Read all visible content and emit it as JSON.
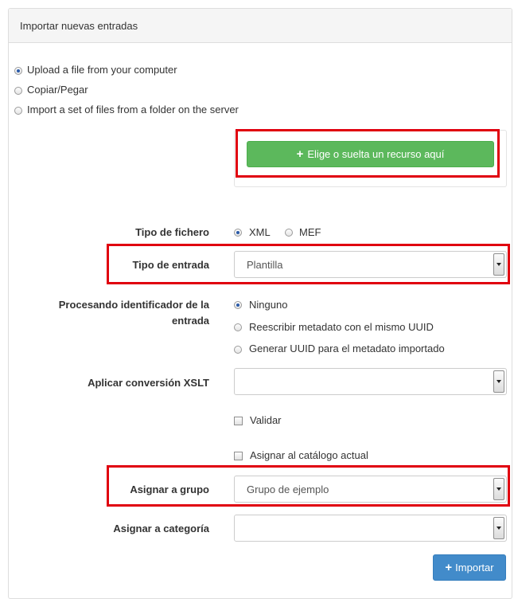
{
  "panel": {
    "title": "Importar nuevas entradas"
  },
  "source_options": [
    {
      "label": "Upload a file from your computer",
      "selected": true
    },
    {
      "label": "Copiar/Pegar",
      "selected": false
    },
    {
      "label": "Import a set of files from a folder on the server",
      "selected": false
    }
  ],
  "upload_button": {
    "icon": "plus-icon",
    "label": "Elige o suelta un recurso aquí"
  },
  "tipo_fichero": {
    "label": "Tipo de fichero",
    "options": [
      {
        "label": "XML",
        "selected": true
      },
      {
        "label": "MEF",
        "selected": false
      }
    ]
  },
  "tipo_entrada": {
    "label": "Tipo de entrada",
    "value": "Plantilla"
  },
  "uuid_processing": {
    "label_line1": "Procesando identificador de la",
    "label_line2": "entrada",
    "options": [
      {
        "label": "Ninguno",
        "selected": true
      },
      {
        "label": "Reescribir metadato con el mismo UUID",
        "selected": false
      },
      {
        "label": "Generar UUID para el metadato importado",
        "selected": false
      }
    ]
  },
  "xslt": {
    "label": "Aplicar conversión XSLT",
    "value": ""
  },
  "validar": {
    "label": "Validar",
    "checked": false
  },
  "asignar_catalogo": {
    "label": "Asignar al catálogo actual",
    "checked": false
  },
  "grupo": {
    "label": "Asignar a grupo",
    "value": "Grupo de ejemplo"
  },
  "categoria": {
    "label": "Asignar a categoría",
    "value": ""
  },
  "import_button": {
    "icon": "plus-icon",
    "label": "Importar"
  },
  "colors": {
    "highlight": "#e0000f",
    "success": "#5cb85c",
    "primary": "#428bca"
  }
}
